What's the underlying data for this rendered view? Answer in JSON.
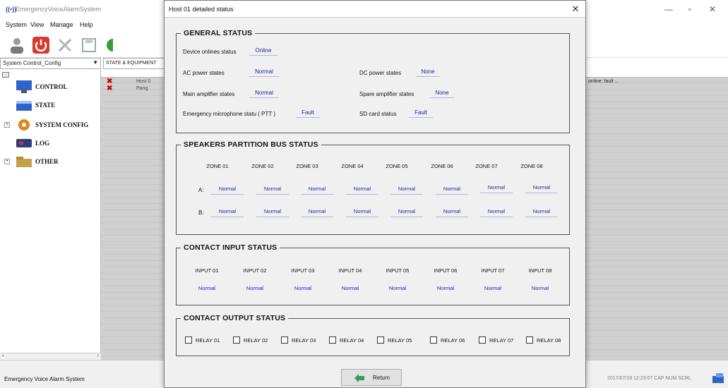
{
  "app": {
    "title": "EmergencyVoiceAlarmSystem",
    "menu": [
      "System",
      "View",
      "Manage",
      "Help"
    ],
    "combo_value": "System Control_Config",
    "tree": [
      {
        "label": "CONTROL",
        "icon": "monitor-icon",
        "color": "#2f63c7"
      },
      {
        "label": "STATE",
        "icon": "state-icon",
        "color": "#2f63c7"
      },
      {
        "label": "SYSTEM CONFIG",
        "icon": "gear-icon",
        "color": "#d98a18"
      },
      {
        "label": "LOG",
        "icon": "log-icon",
        "color": "#2b3d7a"
      },
      {
        "label": "OTHER",
        "icon": "folder-icon",
        "color": "#c9a04a"
      }
    ],
    "tab_label": "STATE & EQUIPMENT",
    "rows": [
      {
        "device": "Host 0",
        "status_text": "online: fault   ..."
      },
      {
        "device": "Pang",
        "status_text": ""
      }
    ],
    "status_left": "Emergency Voice Alarm System",
    "status_right": "2017/07/19 12:23:07   CAP  NUM  SCRL"
  },
  "dialog": {
    "title": "Host 01 detailed status",
    "general": {
      "title": "GENERAL STATUS",
      "device_online_label": "Device onlines status",
      "device_online_value": "Online",
      "ac_label": "AC power states",
      "ac_value": "Normal",
      "dc_label": "DC power states",
      "dc_value": "None",
      "main_amp_label": "Main amplifier  states",
      "main_amp_value": "Normal",
      "spare_amp_label": "Spare amplifier  states",
      "spare_amp_value": "None",
      "mic_label": "Emergency microphone statu ( PTT )",
      "mic_value": "Fault",
      "sd_label": "SD card status",
      "sd_value": "Fault"
    },
    "speakers": {
      "title": "SPEAKERS PARTITION BUS STATUS",
      "zones": [
        "ZONE 01",
        "ZONE 02",
        "ZONE 03",
        "ZONE 04",
        "ZONE 05",
        "ZONE 06",
        "ZONE 07",
        "ZONE 08"
      ],
      "row_a_label": "A:",
      "row_b_label": "B:",
      "row_a": [
        "Normal",
        "Normal",
        "Normal",
        "Normal",
        "Normal",
        "Normal",
        "Normal",
        "Normal"
      ],
      "row_b": [
        "Normal",
        "Normal",
        "Normal",
        "Normal",
        "Normal",
        "Normal",
        "Normal",
        "Normal"
      ]
    },
    "inputs": {
      "title": "CONTACT INPUT STATUS",
      "labels": [
        "INPUT 01",
        "INPUT 02",
        "INPUT 03",
        "INPUT 04",
        "INPUT 05",
        "INPUT 06",
        "INPUT 07",
        "INPUT 08"
      ],
      "values": [
        "Normal",
        "Normal",
        "Normal",
        "Normal",
        "Normal",
        "Normal",
        "Normal",
        "Normal"
      ]
    },
    "outputs": {
      "title": "CONTACT OUTPUT STATUS",
      "relays": [
        "RELAY 01",
        "RELAY 02",
        "RELAY 03",
        "RELAY 04",
        "RELAY 05",
        "RELAY 06",
        "RELAY 07",
        "RELAY 08"
      ],
      "checked": [
        false,
        false,
        false,
        false,
        false,
        false,
        false,
        false
      ]
    },
    "return_label": "Return"
  }
}
